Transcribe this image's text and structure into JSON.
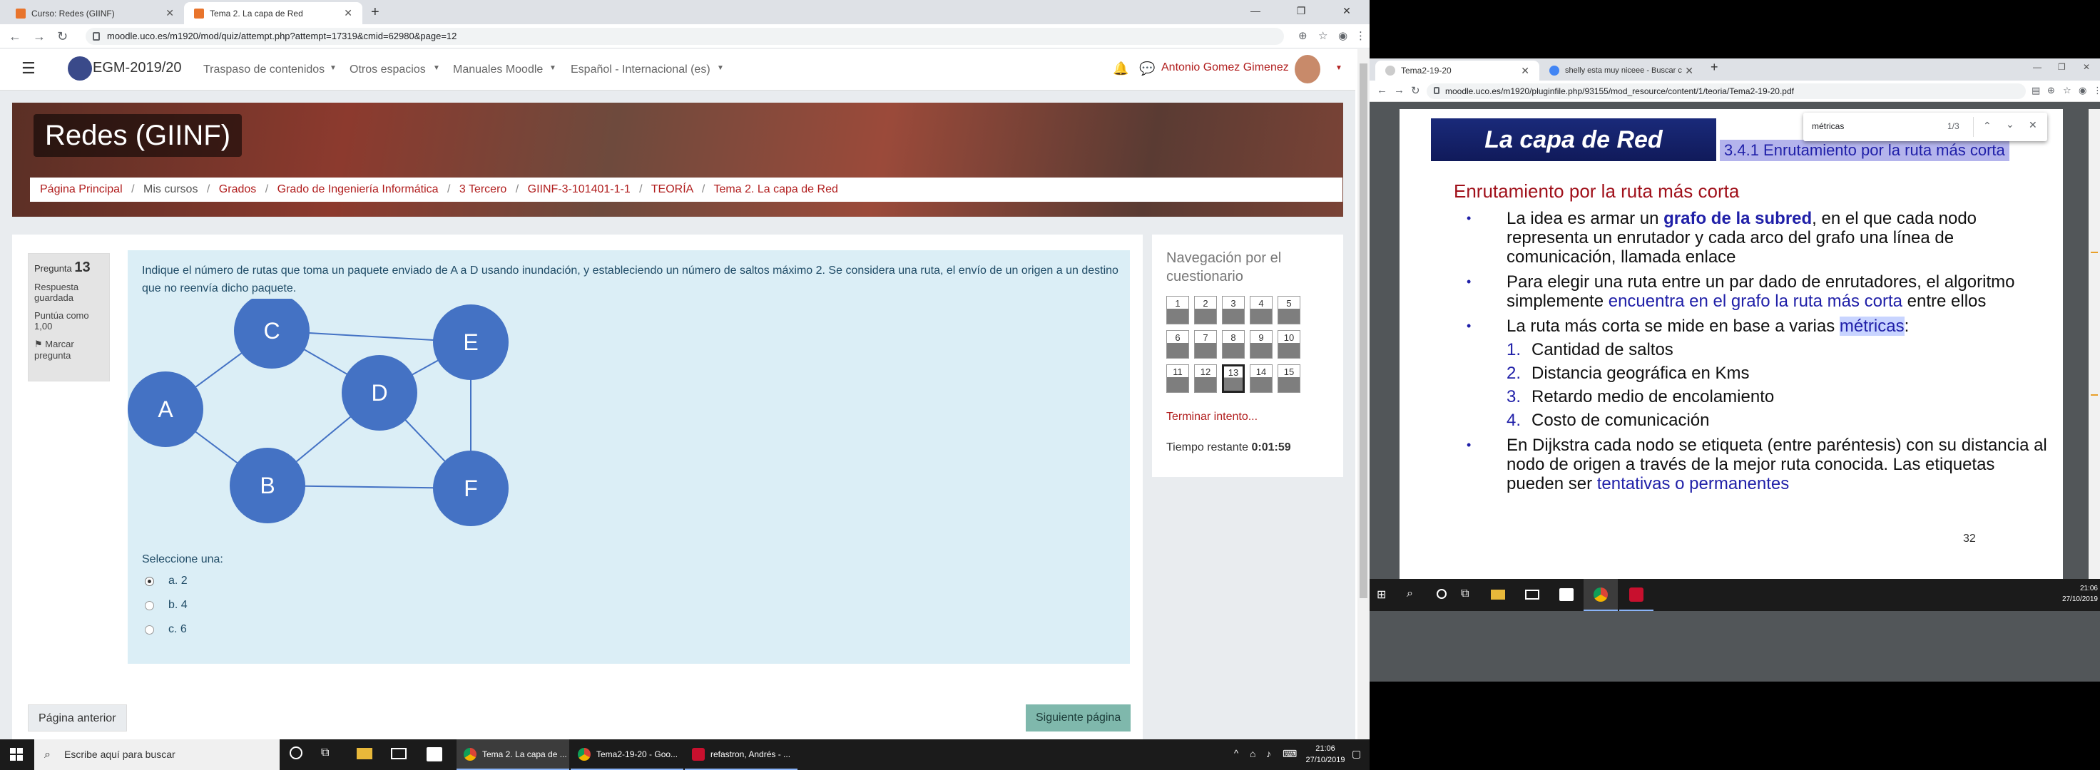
{
  "left_browser": {
    "tabs": [
      {
        "label": "Curso: Redes (GIINF)"
      },
      {
        "label": "Tema 2. La capa de Red"
      }
    ],
    "url": "moodle.uco.es/m1920/mod/quiz/attempt.php?attempt=17319&cmid=62980&page=12",
    "site": {
      "brand": "EGM-2019/20",
      "menus": [
        "Traspaso de contenidos",
        "Otros espacios",
        "Manuales Moodle",
        "Español - Internacional (es)"
      ],
      "user": "Antonio Gomez Gimenez"
    },
    "course_title": "Redes (GIINF)",
    "breadcrumb": [
      "Página Principal",
      "Mis cursos",
      "Grados",
      "Grado de Ingeniería Informática",
      "3 Tercero",
      "GIINF-3-101401-1-1",
      "TEORÍA",
      "Tema 2. La capa de Red"
    ],
    "question": {
      "label": "Pregunta",
      "number": "13",
      "status": "Respuesta guardada",
      "score": "Puntúa como 1,00",
      "flag": "Marcar pregunta",
      "text": "Indique el número de rutas que toma un paquete enviado de A a D usando inundación, y estableciendo un número de saltos máximo 2. Se considera una ruta, el envío de un origen a un destino que no reenvía dicho paquete.",
      "graph_nodes": [
        "A",
        "B",
        "C",
        "D",
        "E",
        "F"
      ],
      "select_prompt": "Seleccione una:",
      "options": [
        {
          "label": "a. 2",
          "selected": true
        },
        {
          "label": "b. 4",
          "selected": false
        },
        {
          "label": "c. 6",
          "selected": false
        }
      ]
    },
    "nav": {
      "title": "Navegación por el cuestionario",
      "buttons": [
        "1",
        "2",
        "3",
        "4",
        "5",
        "6",
        "7",
        "8",
        "9",
        "10",
        "11",
        "12",
        "13",
        "14",
        "15"
      ],
      "current": "13",
      "finish": "Terminar intento...",
      "time_label": "Tiempo restante",
      "time": "0:01:59"
    },
    "prev_button": "Página anterior",
    "next_button": "Siguiente página"
  },
  "left_taskbar": {
    "search": "Escribe aquí para buscar",
    "apps": [
      "Tema 2. La capa de ...",
      "Tema2-19-20 - Goo...",
      "refastron, Andrés - ..."
    ],
    "time": "21:06",
    "date": "27/10/2019"
  },
  "right_browser": {
    "tabs": [
      {
        "label": "Tema2-19-20"
      },
      {
        "label": "shelly esta muy niceee - Buscar c"
      }
    ],
    "url": "moodle.uco.es/m1920/pluginfile.php/93155/mod_resource/content/1/teoria/Tema2-19-20.pdf",
    "find": {
      "query": "métricas",
      "count": "1/3"
    },
    "slide": {
      "header": "La capa de Red",
      "section": "3.4.1 Enrutamiento por la ruta más corta",
      "heading": "Enrutamiento por la ruta más corta",
      "b1": {
        "pre": "La idea es armar un ",
        "bold": "grafo de la subred",
        "post": ", en el que cada nodo representa un enrutador y cada arco del grafo una línea de comunicación, llamada enlace"
      },
      "b2": {
        "pre": "Para elegir una ruta entre un par dado de enrutadores, el algoritmo simplemente ",
        "link": "encuentra en el grafo la ruta más corta",
        "post": " entre ellos"
      },
      "b3": {
        "pre": "La ruta más corta se mide en base a varias ",
        "hl": "métricas",
        "post": ":"
      },
      "metrics": [
        "Cantidad de saltos",
        "Distancia geográfica en Kms",
        "Retardo medio de encolamiento",
        "Costo de comunicación"
      ],
      "b4": {
        "pre": "En Dijkstra cada nodo se etiqueta (entre paréntesis) con su distancia al nodo de origen a través de la mejor ruta conocida. Las etiquetas pueden ser ",
        "link": "tentativas o permanentes"
      },
      "page": "32"
    }
  },
  "right_taskbar": {
    "time": "21:06",
    "date": "27/10/2019"
  },
  "colors": {
    "moodle_red": "#b11e1e",
    "node_blue": "#4472c4",
    "slide_blue": "#1f1fa8"
  }
}
